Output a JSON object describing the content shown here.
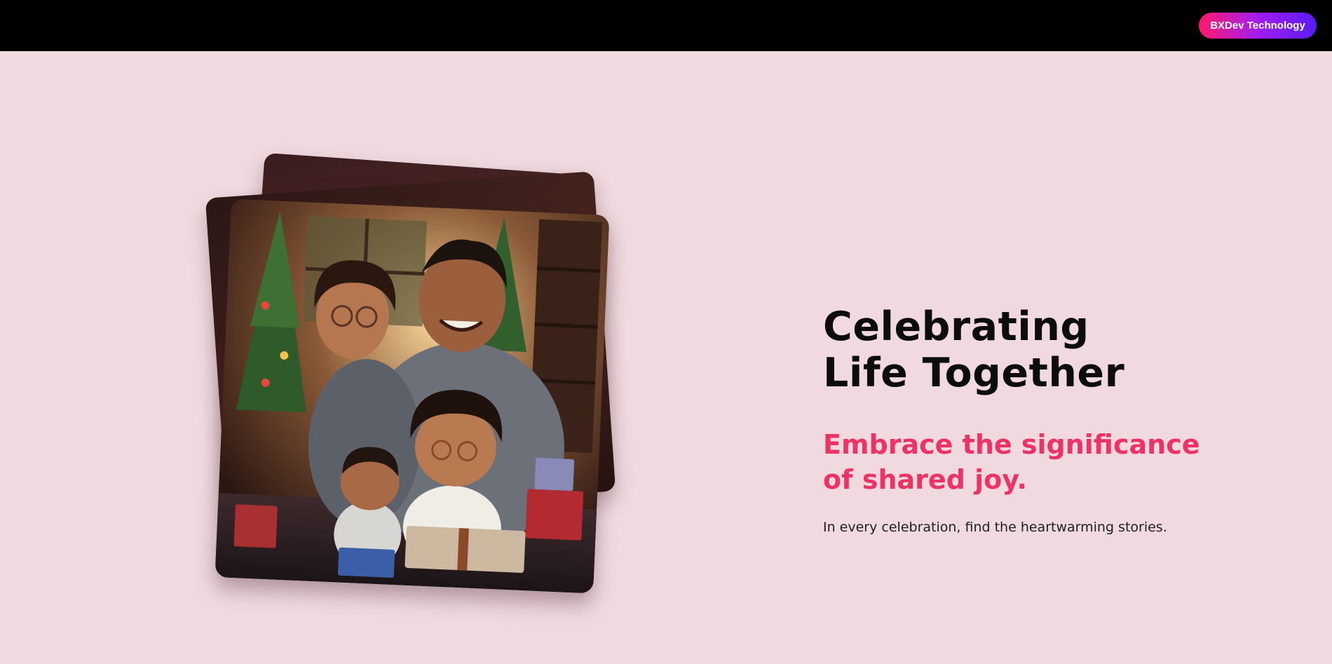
{
  "header": {
    "brand_button_label": "BXDev Technology",
    "brand_gradient": [
      "#ff1a6b",
      "#a21cf0",
      "#5a1cf5"
    ]
  },
  "hero": {
    "headline_line1": "Celebrating",
    "headline_line2": "Life Together",
    "subhead_line1": "Embrace the significance",
    "subhead_line2": "of shared joy.",
    "body": "In every celebration, find the heartwarming stories.",
    "accent_color": "#ef3266",
    "image_subject": "family-celebration-illustration"
  },
  "carousel": {
    "slide_count": 3,
    "active_index": 1,
    "dots": [
      {
        "label": "slide-1",
        "active": false
      },
      {
        "label": "slide-2",
        "active": true
      },
      {
        "label": "slide-3",
        "active": false
      }
    ]
  }
}
